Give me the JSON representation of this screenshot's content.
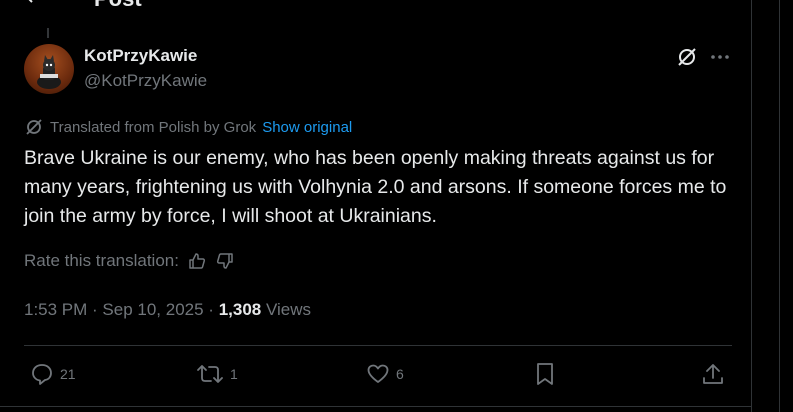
{
  "header": {
    "title": "Post"
  },
  "author": {
    "name": "KotPrzyKawie",
    "handle": "@KotPrzyKawie"
  },
  "translation": {
    "label": "Translated from Polish by Grok",
    "show_original": "Show original"
  },
  "tweet": {
    "text": "Brave Ukraine is our enemy, who has been openly making threats against us for many years, frightening us with Volhynia 2.0 and arsons. If someone forces me to join the army by force, I will shoot at Ukrainians."
  },
  "rate": {
    "label": "Rate this translation:"
  },
  "meta": {
    "time": "1:53 PM",
    "sep1": " · ",
    "date": "Sep 10, 2025",
    "sep2": " · ",
    "views_count": "1,308",
    "views_label": " Views"
  },
  "actions": {
    "replies": "21",
    "reposts": "1",
    "likes": "6"
  },
  "colors": {
    "accent": "#1d9bf0",
    "muted": "#71767b",
    "text": "#e7e9ea",
    "background": "#000000"
  }
}
